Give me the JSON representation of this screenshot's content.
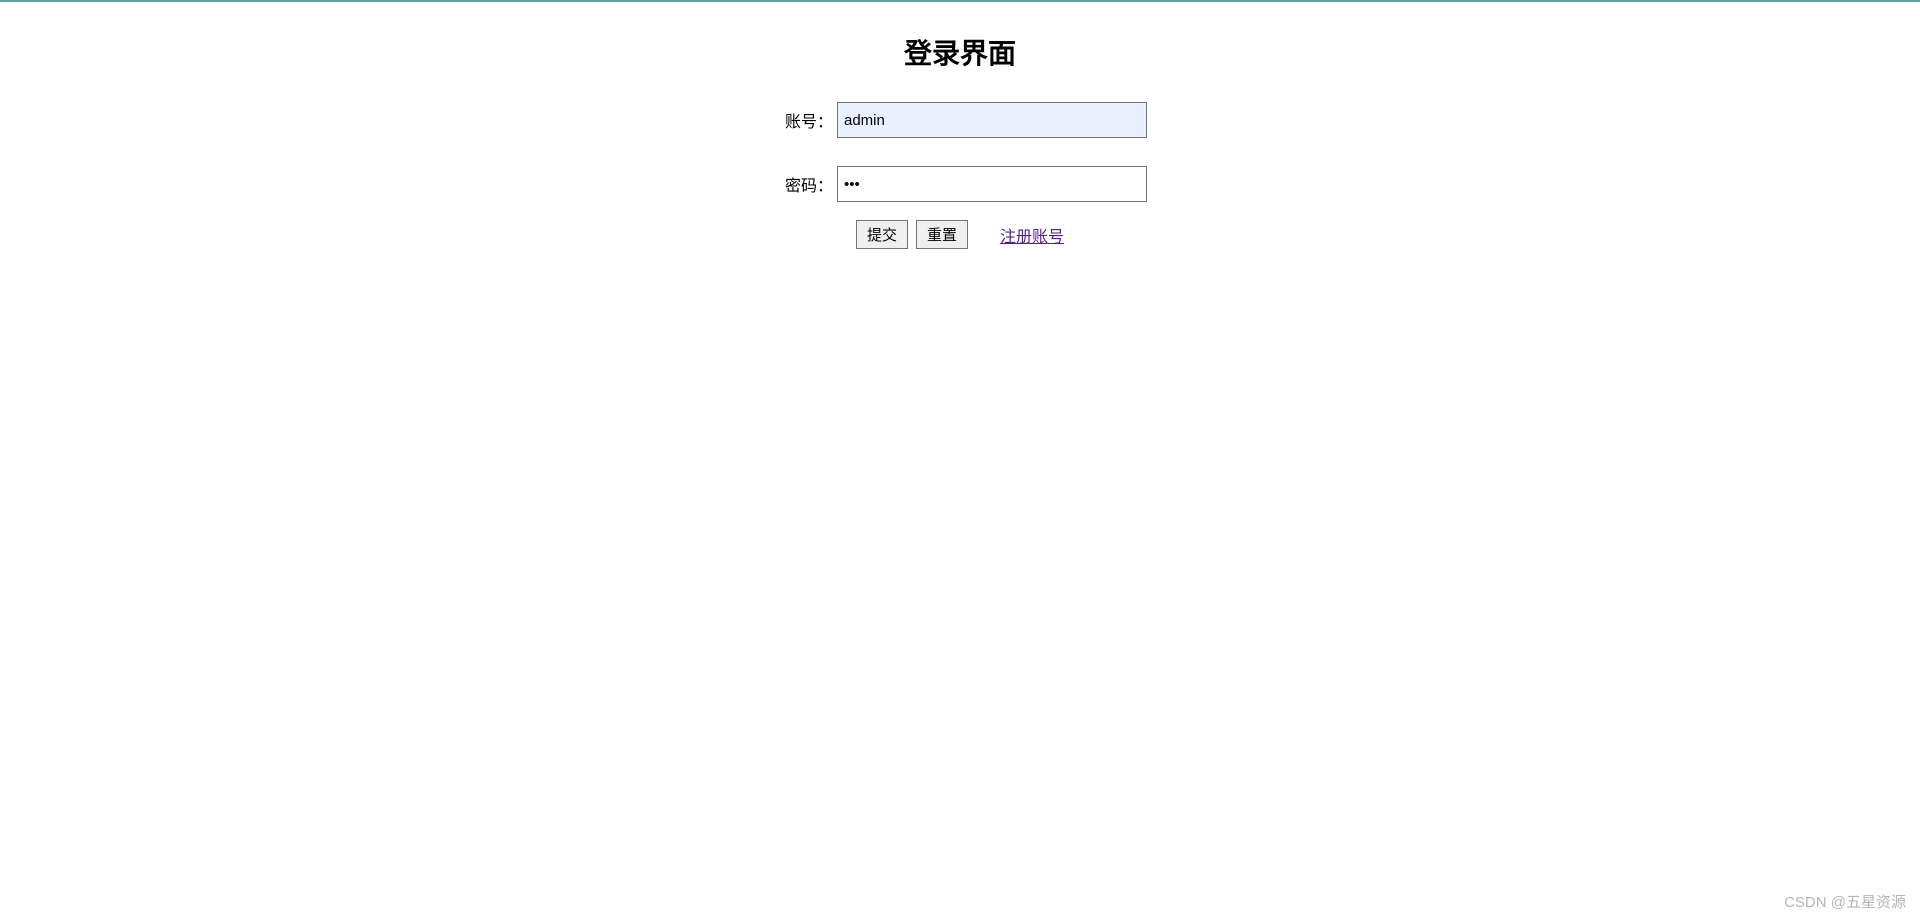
{
  "page": {
    "title": "登录界面"
  },
  "form": {
    "username_label": "账号：",
    "username_value": "admin",
    "password_label": "密码：",
    "password_value": "123"
  },
  "actions": {
    "submit_label": "提交",
    "reset_label": "重置",
    "register_link_label": "注册账号"
  },
  "watermark": {
    "text": "CSDN @五星资源"
  }
}
